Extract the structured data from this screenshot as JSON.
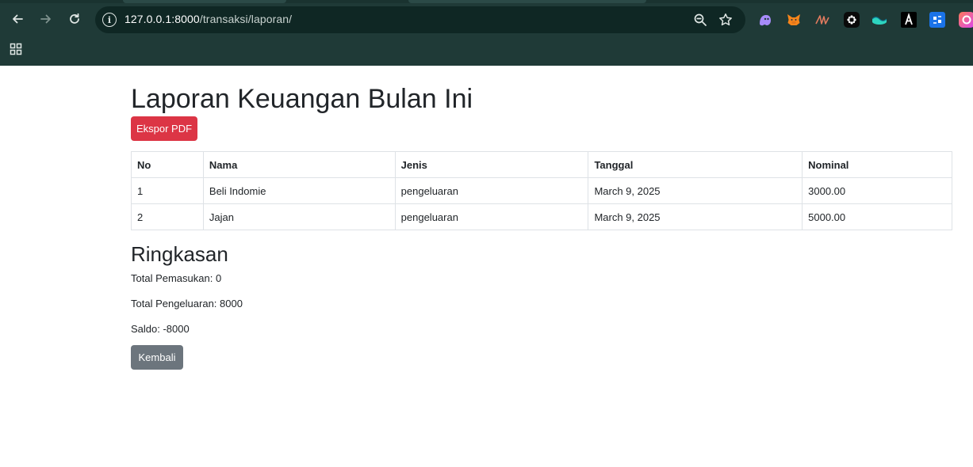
{
  "browser": {
    "url_host": "127.0.0.1:8000",
    "url_path": "/transaksi/laporan/",
    "site_info_glyph": "i",
    "accent_color": "#1f3a37"
  },
  "page": {
    "title": "Laporan Keuangan Bulan Ini",
    "export_button": "Ekspor PDF",
    "table": {
      "headers": [
        "No",
        "Nama",
        "Jenis",
        "Tanggal",
        "Nominal"
      ],
      "rows": [
        [
          "1",
          "Beli Indomie",
          "pengeluaran",
          "March 9, 2025",
          "3000.00"
        ],
        [
          "2",
          "Jajan",
          "pengeluaran",
          "March 9, 2025",
          "5000.00"
        ]
      ]
    },
    "summary": {
      "title": "Ringkasan",
      "income": "Total Pemasukan: 0",
      "expense": "Total Pengeluaran: 8000",
      "balance": "Saldo: -8000"
    },
    "back_button": "Kembali",
    "colors": {
      "danger": "#dc3545",
      "secondary": "#6c757d"
    }
  }
}
